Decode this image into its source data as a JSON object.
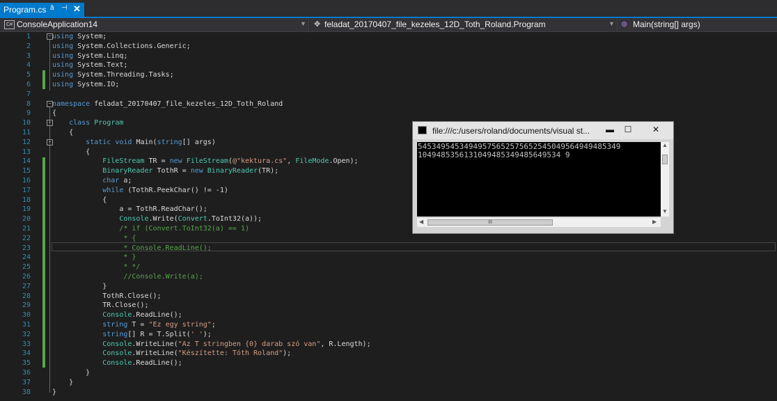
{
  "tab": {
    "title": "Program.cs",
    "pin_icon": "pin-icon",
    "close_glyph": "✕"
  },
  "navbar": {
    "project": "ConsoleApplication14",
    "class_path": "feladat_20170407_file_kezeles_12D_Toth_Roland.Program",
    "member": "Main(string[] args)"
  },
  "editor": {
    "line_numbers": [
      "1",
      "2",
      "3",
      "4",
      "5",
      "6",
      "7",
      "8",
      "9",
      "10",
      "11",
      "12",
      "13",
      "14",
      "15",
      "16",
      "17",
      "18",
      "19",
      "20",
      "21",
      "22",
      "23",
      "24",
      "25",
      "26",
      "27",
      "28",
      "29",
      "30",
      "31",
      "32",
      "33",
      "34",
      "35",
      "36",
      "37",
      "38"
    ],
    "lines": [
      [
        {
          "t": "kw",
          "v": "using"
        },
        {
          "t": "",
          "v": " System;"
        }
      ],
      [
        {
          "t": "kw",
          "v": "using"
        },
        {
          "t": "",
          "v": " System.Collections.Generic;"
        }
      ],
      [
        {
          "t": "kw",
          "v": "using"
        },
        {
          "t": "",
          "v": " System.Linq;"
        }
      ],
      [
        {
          "t": "kw",
          "v": "using"
        },
        {
          "t": "",
          "v": " System.Text;"
        }
      ],
      [
        {
          "t": "kw",
          "v": "using"
        },
        {
          "t": "",
          "v": " System.Threading.Tasks;"
        }
      ],
      [
        {
          "t": "kw",
          "v": "using"
        },
        {
          "t": "",
          "v": " System.IO;"
        }
      ],
      [],
      [
        {
          "t": "kw",
          "v": "namespace"
        },
        {
          "t": "",
          "v": " feladat_20170407_file_kezeles_12D_Toth_Roland"
        }
      ],
      [
        {
          "t": "",
          "v": "{"
        }
      ],
      [
        {
          "t": "",
          "v": "    "
        },
        {
          "t": "kw",
          "v": "class"
        },
        {
          "t": "",
          "v": " "
        },
        {
          "t": "ty",
          "v": "Program"
        }
      ],
      [
        {
          "t": "",
          "v": "    {"
        }
      ],
      [
        {
          "t": "",
          "v": "        "
        },
        {
          "t": "kw",
          "v": "static"
        },
        {
          "t": "",
          "v": " "
        },
        {
          "t": "kw",
          "v": "void"
        },
        {
          "t": "",
          "v": " Main("
        },
        {
          "t": "kw",
          "v": "string"
        },
        {
          "t": "",
          "v": "[] args)"
        }
      ],
      [
        {
          "t": "",
          "v": "        {"
        }
      ],
      [
        {
          "t": "",
          "v": "            "
        },
        {
          "t": "ty",
          "v": "FileStream"
        },
        {
          "t": "",
          "v": " TR = "
        },
        {
          "t": "kw",
          "v": "new"
        },
        {
          "t": "",
          "v": " "
        },
        {
          "t": "ty",
          "v": "FileStream"
        },
        {
          "t": "",
          "v": "("
        },
        {
          "t": "st",
          "v": "@\"kektura.cs\""
        },
        {
          "t": "",
          "v": ", "
        },
        {
          "t": "ty",
          "v": "FileMode"
        },
        {
          "t": "",
          "v": ".Open);"
        }
      ],
      [
        {
          "t": "",
          "v": "            "
        },
        {
          "t": "ty",
          "v": "BinaryReader"
        },
        {
          "t": "",
          "v": " TothR = "
        },
        {
          "t": "kw",
          "v": "new"
        },
        {
          "t": "",
          "v": " "
        },
        {
          "t": "ty",
          "v": "BinaryReader"
        },
        {
          "t": "",
          "v": "(TR);"
        }
      ],
      [
        {
          "t": "",
          "v": "            "
        },
        {
          "t": "kw",
          "v": "char"
        },
        {
          "t": "",
          "v": " a;"
        }
      ],
      [
        {
          "t": "",
          "v": "            "
        },
        {
          "t": "kw",
          "v": "while"
        },
        {
          "t": "",
          "v": " (TothR.PeekChar() != -1)"
        }
      ],
      [
        {
          "t": "",
          "v": "            {"
        }
      ],
      [
        {
          "t": "",
          "v": "                a = TothR.ReadChar();"
        }
      ],
      [
        {
          "t": "",
          "v": "                "
        },
        {
          "t": "ty",
          "v": "Console"
        },
        {
          "t": "",
          "v": ".Write("
        },
        {
          "t": "ty",
          "v": "Convert"
        },
        {
          "t": "",
          "v": ".ToInt32(a));"
        }
      ],
      [
        {
          "t": "",
          "v": "                "
        },
        {
          "t": "cm",
          "v": "/* if (Convert.ToInt32(a) == 1)"
        }
      ],
      [
        {
          "t": "cm",
          "v": "                 * {"
        }
      ],
      [
        {
          "t": "cm",
          "v": "                 * Console.ReadLine();"
        }
      ],
      [
        {
          "t": "cm",
          "v": "                 * }"
        }
      ],
      [
        {
          "t": "cm",
          "v": "                 * */"
        }
      ],
      [
        {
          "t": "",
          "v": "                 "
        },
        {
          "t": "cm",
          "v": "//Console.Write(a);"
        }
      ],
      [
        {
          "t": "",
          "v": "            }"
        }
      ],
      [
        {
          "t": "",
          "v": "            TothR.Close();"
        }
      ],
      [
        {
          "t": "",
          "v": "            TR.Close();"
        }
      ],
      [
        {
          "t": "",
          "v": "            "
        },
        {
          "t": "ty",
          "v": "Console"
        },
        {
          "t": "",
          "v": ".ReadLine();"
        }
      ],
      [
        {
          "t": "",
          "v": "            "
        },
        {
          "t": "kw",
          "v": "string"
        },
        {
          "t": "",
          "v": " T = "
        },
        {
          "t": "st",
          "v": "\"Ez egy string\""
        },
        {
          "t": "",
          "v": ";"
        }
      ],
      [
        {
          "t": "",
          "v": "            "
        },
        {
          "t": "kw",
          "v": "string"
        },
        {
          "t": "",
          "v": "[] R = T.Split("
        },
        {
          "t": "st",
          "v": "' '"
        },
        {
          "t": "",
          "v": ");"
        }
      ],
      [
        {
          "t": "",
          "v": "            "
        },
        {
          "t": "ty",
          "v": "Console"
        },
        {
          "t": "",
          "v": ".WriteLine("
        },
        {
          "t": "st",
          "v": "\"Az T stringben {0} darab szó van\""
        },
        {
          "t": "",
          "v": ", R.Length);"
        }
      ],
      [
        {
          "t": "",
          "v": "            "
        },
        {
          "t": "ty",
          "v": "Console"
        },
        {
          "t": "",
          "v": ".WriteLine("
        },
        {
          "t": "st",
          "v": "\"Készítette: Tóth Roland\""
        },
        {
          "t": "",
          "v": ");"
        }
      ],
      [
        {
          "t": "",
          "v": "            "
        },
        {
          "t": "ty",
          "v": "Console"
        },
        {
          "t": "",
          "v": ".ReadLine();"
        }
      ],
      [
        {
          "t": "",
          "v": "        }"
        }
      ],
      [
        {
          "t": "",
          "v": "    }"
        }
      ],
      [
        {
          "t": "",
          "v": "}"
        }
      ]
    ]
  },
  "console": {
    "title": "file:///c:/users/roland/documents/visual st...",
    "output": "54534954534949575652575652545049564949485349\n1049485356131049485349485649534 9",
    "minimize": "▬",
    "maximize": "☐",
    "close": "✕",
    "hthumb_grip": "III"
  },
  "colors": {
    "accent": "#007acc",
    "keyword": "#569cd6",
    "type": "#4ec9b0",
    "string": "#d69d85",
    "comment": "#57a64a"
  }
}
